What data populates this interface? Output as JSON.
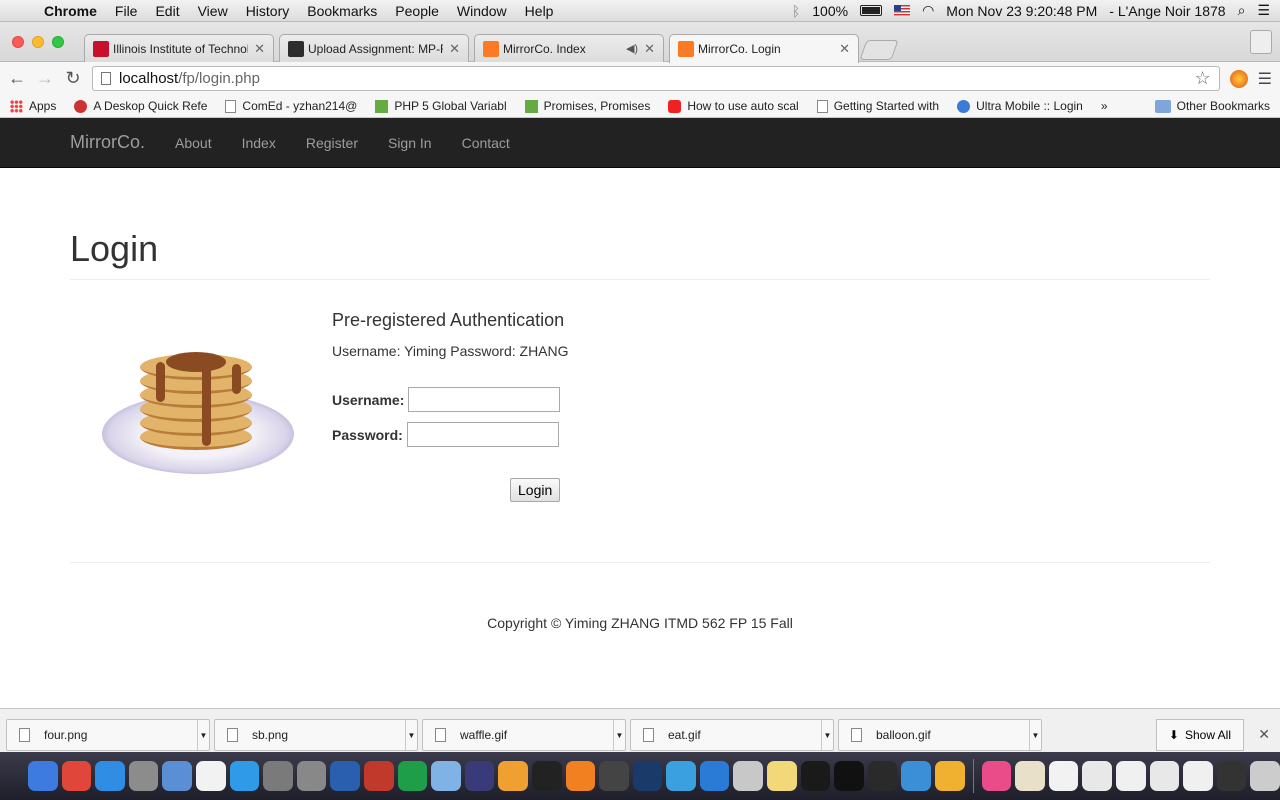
{
  "menubar": {
    "app_name": "Chrome",
    "items": [
      "File",
      "Edit",
      "View",
      "History",
      "Bookmarks",
      "People",
      "Window",
      "Help"
    ],
    "battery": "100%",
    "datetime": "Mon Nov 23  9:20:48 PM",
    "user": "- L'Ange Noir 1878"
  },
  "tabs": [
    {
      "title": "Illinois Institute of Technolo",
      "favicon": "iit-icon"
    },
    {
      "title": "Upload Assignment: MP-Fi",
      "favicon": "blackboard-icon"
    },
    {
      "title": "MirrorCo. Index",
      "favicon": "xampp-icon",
      "audio": true
    },
    {
      "title": "MirrorCo. Login",
      "favicon": "xampp-icon",
      "active": true
    }
  ],
  "address": {
    "host": "localhost",
    "path": "/fp/login.php"
  },
  "bookmarks": [
    {
      "label": "Apps",
      "icon": "apps-grid-icon"
    },
    {
      "label": "A Deskop Quick Refe",
      "icon": "a-icon"
    },
    {
      "label": "ComEd - yzhan214@",
      "icon": "doc-icon"
    },
    {
      "label": "PHP 5 Global Variabl",
      "icon": "w3-icon"
    },
    {
      "label": "Promises, Promises",
      "icon": "green-icon"
    },
    {
      "label": "How to use auto scal",
      "icon": "youtube-icon"
    },
    {
      "label": "Getting Started with",
      "icon": "doc-icon"
    },
    {
      "label": "Ultra Mobile :: Login",
      "icon": "ultra-icon"
    }
  ],
  "bookmarks_more": "»",
  "bookmarks_other": "Other Bookmarks",
  "site": {
    "brand": "MirrorCo.",
    "nav": [
      "About",
      "Index",
      "Register",
      "Sign In",
      "Contact"
    ],
    "heading": "Login",
    "subheading": "Pre-registered Authentication",
    "credentials": "Username: Yiming Password: ZHANG",
    "username_label": "Username:",
    "password_label": "Password:",
    "username_value": "",
    "password_value": "",
    "login_button": "Login",
    "footer": "Copyright © Yiming ZHANG ITMD 562 FP 15 Fall"
  },
  "downloads": [
    "four.png",
    "sb.png",
    "waffle.gif",
    "eat.gif",
    "balloon.gif"
  ],
  "show_all": "Show All",
  "dock_colors": [
    "#3d7be0",
    "#e0463a",
    "#2f8de4",
    "#8c8c8c",
    "#5a8fd6",
    "#f2f2f2",
    "#2f9be8",
    "#7a7a7a",
    "#888",
    "#2a5fb0",
    "#c0392b",
    "#1f9e4a",
    "#7fb3e6",
    "#3a3a7a",
    "#f0a030",
    "#222",
    "#f08020",
    "#444",
    "#1a3a6a",
    "#3aa0e0",
    "#2a7bd6",
    "#c8c8c8",
    "#f2d878",
    "#1a1a1a",
    "#111",
    "#2a2a2a",
    "#3a8fd6",
    "#f0b030",
    "#ea4c89",
    "#e8e0c8",
    "#f2f2f2",
    "#e8e8e8",
    "#f0f0f0",
    "#e8e8e8",
    "#f0f0f0",
    "#333",
    "#ccc"
  ]
}
